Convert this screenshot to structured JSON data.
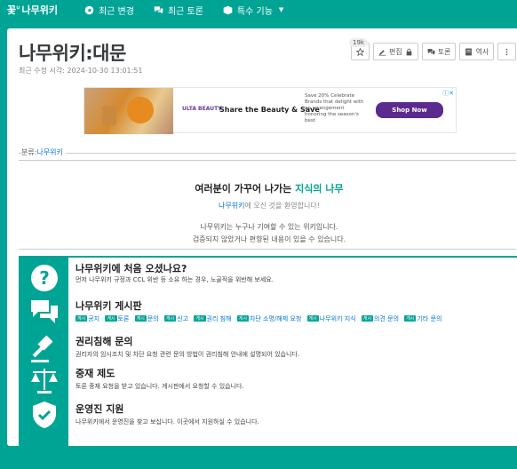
{
  "nav": {
    "logo": "나무위키",
    "logo_prefix": "꽃ᐡ",
    "items": [
      {
        "label": "최근 변경",
        "icon": "compass-icon"
      },
      {
        "label": "최근 토론",
        "icon": "comments-icon"
      },
      {
        "label": "특수 기능",
        "icon": "cube-icon",
        "has_dropdown": true
      }
    ]
  },
  "page": {
    "title": "나무위키:대문",
    "edited": "최근 수정 시각: 2024-10-30 13:01:51",
    "star_count": "19k",
    "actions": [
      {
        "label": "",
        "icon": "star-icon"
      },
      {
        "label": "편집",
        "icon": "edit-icon"
      },
      {
        "label": "토론",
        "icon": "comments-icon"
      },
      {
        "label": "역사",
        "icon": "history-icon"
      }
    ]
  },
  "ad": {
    "brand": "ULTA BEAUTY",
    "headline": "Share the Beauty & Save",
    "copy": "Save 20% Celebrate Brands that delight with an arrangement honoring the season's best",
    "cta": "Shop Now",
    "close": "ⓘ✕"
  },
  "category": {
    "label": "분류:",
    "link": "나무위키"
  },
  "welcome": {
    "heading_pre": "여러분이 가꾸어 나가는 ",
    "heading_accent": "지식의 나무",
    "subtitle_link": "나무위키",
    "subtitle_rest": "에 오신 것을 환영합니다!",
    "body_line1": "나무위키는 누구나 기여할 수 있는 위키입니다.",
    "body_line2": "검증되지 않았거나 편향된 내용이 있을 수 있습니다."
  },
  "sections": [
    {
      "title": "나무위키에 처음 오셨나요?",
      "icon": "question-icon",
      "desc": "먼저 나무위키 규정과 CCL 위반 등 소유 하는 경우, 노골적을 위반해 보세요."
    },
    {
      "title": "나무위키 게시판",
      "icon": "chat-bubbles-icon",
      "links": [
        "공지",
        "토론",
        "문의",
        "신고",
        "권리 침해",
        "차단 소명/해제 요청",
        "나무위키 지식",
        "의견 문의",
        "기타 문의"
      ]
    },
    {
      "title": "권리침해 문의",
      "icon": "gavel-icon",
      "desc": "권리자의 임시조치 및 차단 요청 관련 문의 방법이 권리침해 안내에 설명되어 있습니다."
    },
    {
      "title": "중재 제도",
      "icon": "scale-icon",
      "desc": "토론 중재 요청을 받고 있습니다. 게시판에서 요청할 수 있습니다."
    },
    {
      "title": "운영진 지원",
      "icon": "shield-check-icon",
      "desc": "나무위키에서 운영진을 찾고 보십니다. 이곳에서 지원하실 수 있습니다."
    }
  ]
}
